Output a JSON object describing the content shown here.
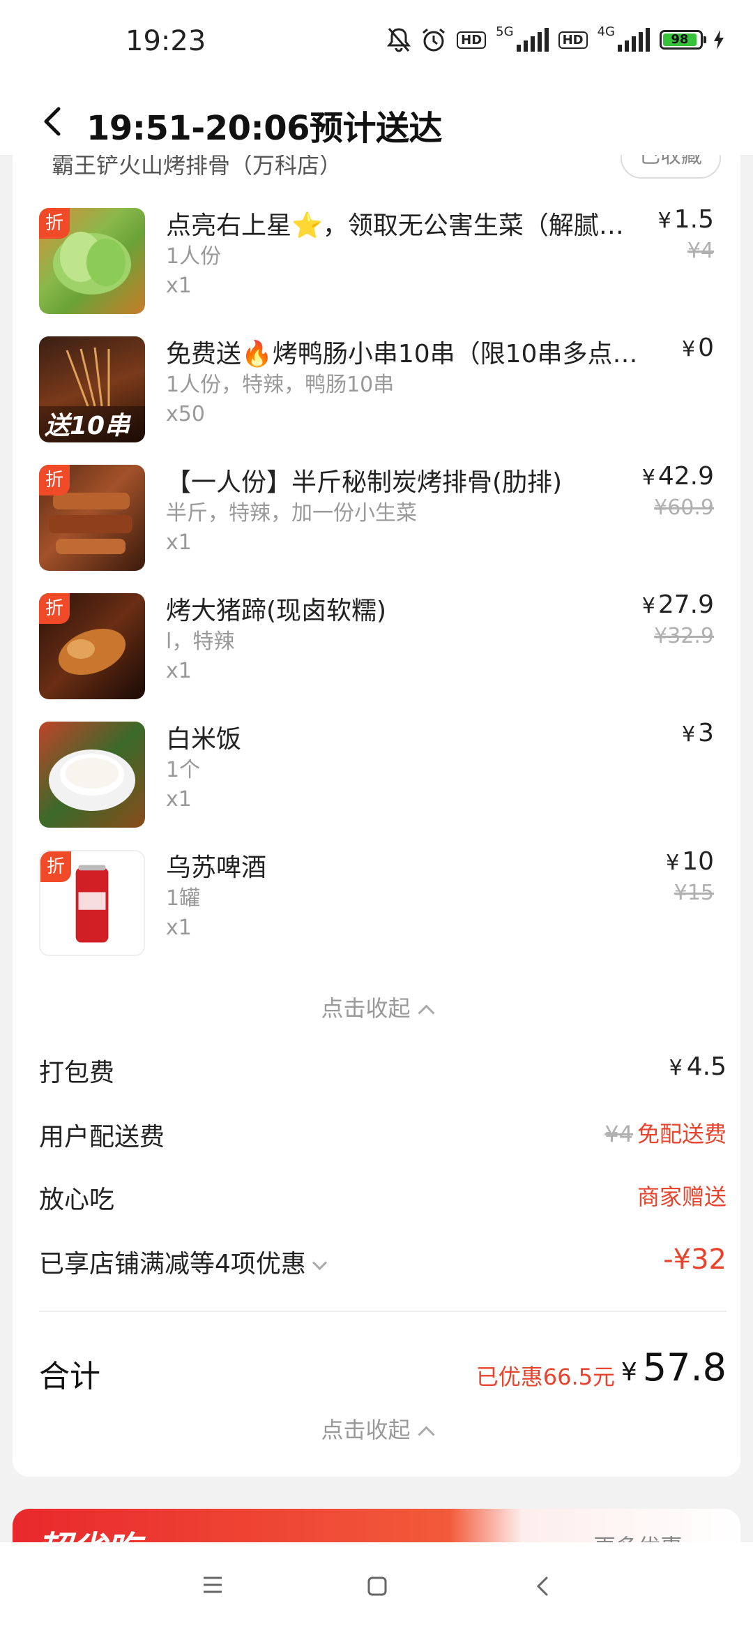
{
  "status_bar": {
    "time": "19:23",
    "net1": "5G",
    "net2": "4G",
    "hd": "HD",
    "battery": "98"
  },
  "header": {
    "title": "19:51-20:06预计送达"
  },
  "store": {
    "name": "霸王铲火山烤排骨（万科店）",
    "fav_label": "已收藏"
  },
  "items": [
    {
      "name": "点亮右上星⭐，领取无公害生菜（解腻…",
      "spec": "1人份",
      "qty": "x1",
      "price": "1.5",
      "orig": "¥4",
      "discount_tag": "折",
      "thumb": "lettuce"
    },
    {
      "name": "免费送🔥烤鸭肠小串10串（限10串多点不…",
      "spec": "1人份，特辣，鸭肠10串",
      "qty": "x50",
      "price": "0",
      "orig": "",
      "thumb": "skewers",
      "thumb_label": "送10串"
    },
    {
      "name": "【一人份】半斤秘制炭烤排骨(肋排)",
      "spec": "半斤，特辣，加一份小生菜",
      "qty": "x1",
      "price": "42.9",
      "orig": "¥60.9",
      "discount_tag": "折",
      "thumb": "ribs"
    },
    {
      "name": "烤大猪蹄(现卤软糯)",
      "spec": "l，特辣",
      "qty": "x1",
      "price": "27.9",
      "orig": "¥32.9",
      "discount_tag": "折",
      "thumb": "trotter"
    },
    {
      "name": "白米饭",
      "spec": "1个",
      "qty": "x1",
      "price": "3",
      "orig": "",
      "thumb": "rice"
    },
    {
      "name": "乌苏啤酒",
      "spec": "1罐",
      "qty": "x1",
      "price": "10",
      "orig": "¥15",
      "discount_tag": "折",
      "thumb": "beer"
    }
  ],
  "collapse_label": "点击收起",
  "fees": {
    "packing": {
      "label": "打包费",
      "value": "4.5"
    },
    "delivery": {
      "label": "用户配送费",
      "orig": "¥4",
      "value": "免配送费"
    },
    "assurance": {
      "label": "放心吃",
      "value": "商家赠送"
    },
    "discounts": {
      "label": "已享店铺满减等4项优惠",
      "value": "-¥32"
    }
  },
  "total": {
    "label": "合计",
    "saved": "已优惠66.5元",
    "amount": "57.8"
  },
  "promo": {
    "title": "超省吃",
    "more": "更多优惠 ›"
  },
  "yen": "¥",
  "colors": {
    "accent": "#e8432c",
    "discount_tag": "#f04a28"
  }
}
